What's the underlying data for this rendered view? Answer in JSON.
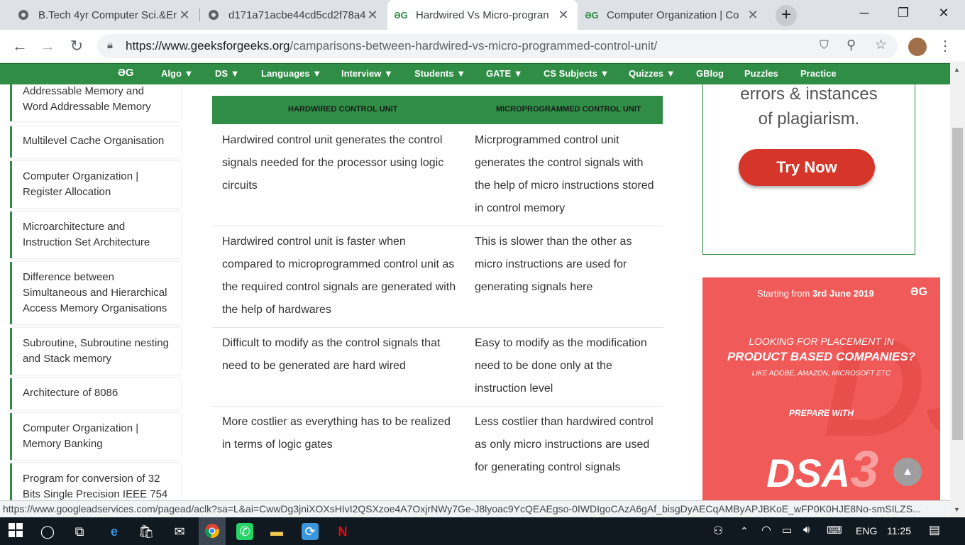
{
  "browser": {
    "tabs": [
      {
        "title": "B.Tech 4yr Computer Sci.&Er",
        "icon": "globe-icon"
      },
      {
        "title": "d171a71acbe44cd5cd2f78a4",
        "icon": "globe-icon"
      },
      {
        "title": "Hardwired Vs Micro-progran",
        "icon": "gfg-logo-icon",
        "active": true
      },
      {
        "title": "Computer Organization | Co",
        "icon": "gfg-logo-icon"
      }
    ],
    "url_host": "https://www.geeksforgeeks.org",
    "url_path": "/camparisons-between-hardwired-vs-micro-programmed-control-unit/"
  },
  "gfg_nav": {
    "logo": "ƏG",
    "items": [
      "Algo ▼",
      "DS ▼",
      "Languages ▼",
      "Interview ▼",
      "Students ▼",
      "GATE ▼",
      "CS Subjects ▼",
      "Quizzes ▼",
      "GBlog",
      "Puzzles",
      "Practice"
    ]
  },
  "sidebar": {
    "items": [
      "Addressable Memory and Word Addressable Memory",
      "Multilevel Cache Organisation",
      "Computer Organization | Register Allocation",
      "Microarchitecture and Instruction Set Architecture",
      "Difference between Simultaneous and Hierarchical Access Memory Organisations",
      "Subroutine, Subroutine nesting and Stack memory",
      "Architecture of 8086",
      "Computer Organization | Memory Banking",
      "Program for conversion of 32 Bits Single Precision IEEE 754"
    ]
  },
  "table": {
    "headers": [
      "HARDWIRED CONTROL UNIT",
      "MICROPROGRAMMED CONTROL UNIT"
    ],
    "rows": [
      [
        "Hardwired control unit generates the control signals needed for the processor using logic circuits",
        "Micrprogrammed control unit generates the control signals with the help of micro instructions stored in control memory"
      ],
      [
        "Hardwired control unit is faster when compared to microprogrammed control unit as the required control signals are generated with the help of hardwares",
        "This is slower than the other as micro instructions are used for generating signals here"
      ],
      [
        "Difficult to modify as the control signals that need to be generated are hard wired",
        "Easy to modify as the modification need to be done only at the instruction level"
      ],
      [
        "More costlier as everything has to be realized in terms of logic gates",
        "Less costlier than hardwired control as only micro instructions are used for generating control signals"
      ]
    ]
  },
  "promo": {
    "line1": "errors & instances",
    "line2": "of plagiarism.",
    "button": "Try Now"
  },
  "ad": {
    "starting": "Starting from",
    "date": "3rd June 2019",
    "logo": "ƏG",
    "line1": "LOOKING FOR PLACEMENT IN",
    "line2": "PRODUCT BASED COMPANIES?",
    "line3": "LIKE ADOBE, AMAZON, MICROSOFT ETC",
    "line4": "PREPARE WITH",
    "brand": "DSA",
    "brand_num": "3",
    "bg_text": "DSA"
  },
  "status_url": "https://www.googleadservices.com/pagead/aclk?sa=L&ai=CwwDg3jniXOXsHIvI2QSXzoe4A7OxjrNWy7Ge-J8lyoac9YcQEAEgso-0IWDIgoCAzA6gAf_bisgDyAECqAMByAPJBKoE_wFP0K0HJE8No-smSILZS...",
  "taskbar": {
    "lang": "ENG",
    "time": "11:25"
  },
  "colors": {
    "gfg_green": "#2f8d46",
    "try_red": "#d6352a",
    "ad_red": "#f05a58"
  }
}
